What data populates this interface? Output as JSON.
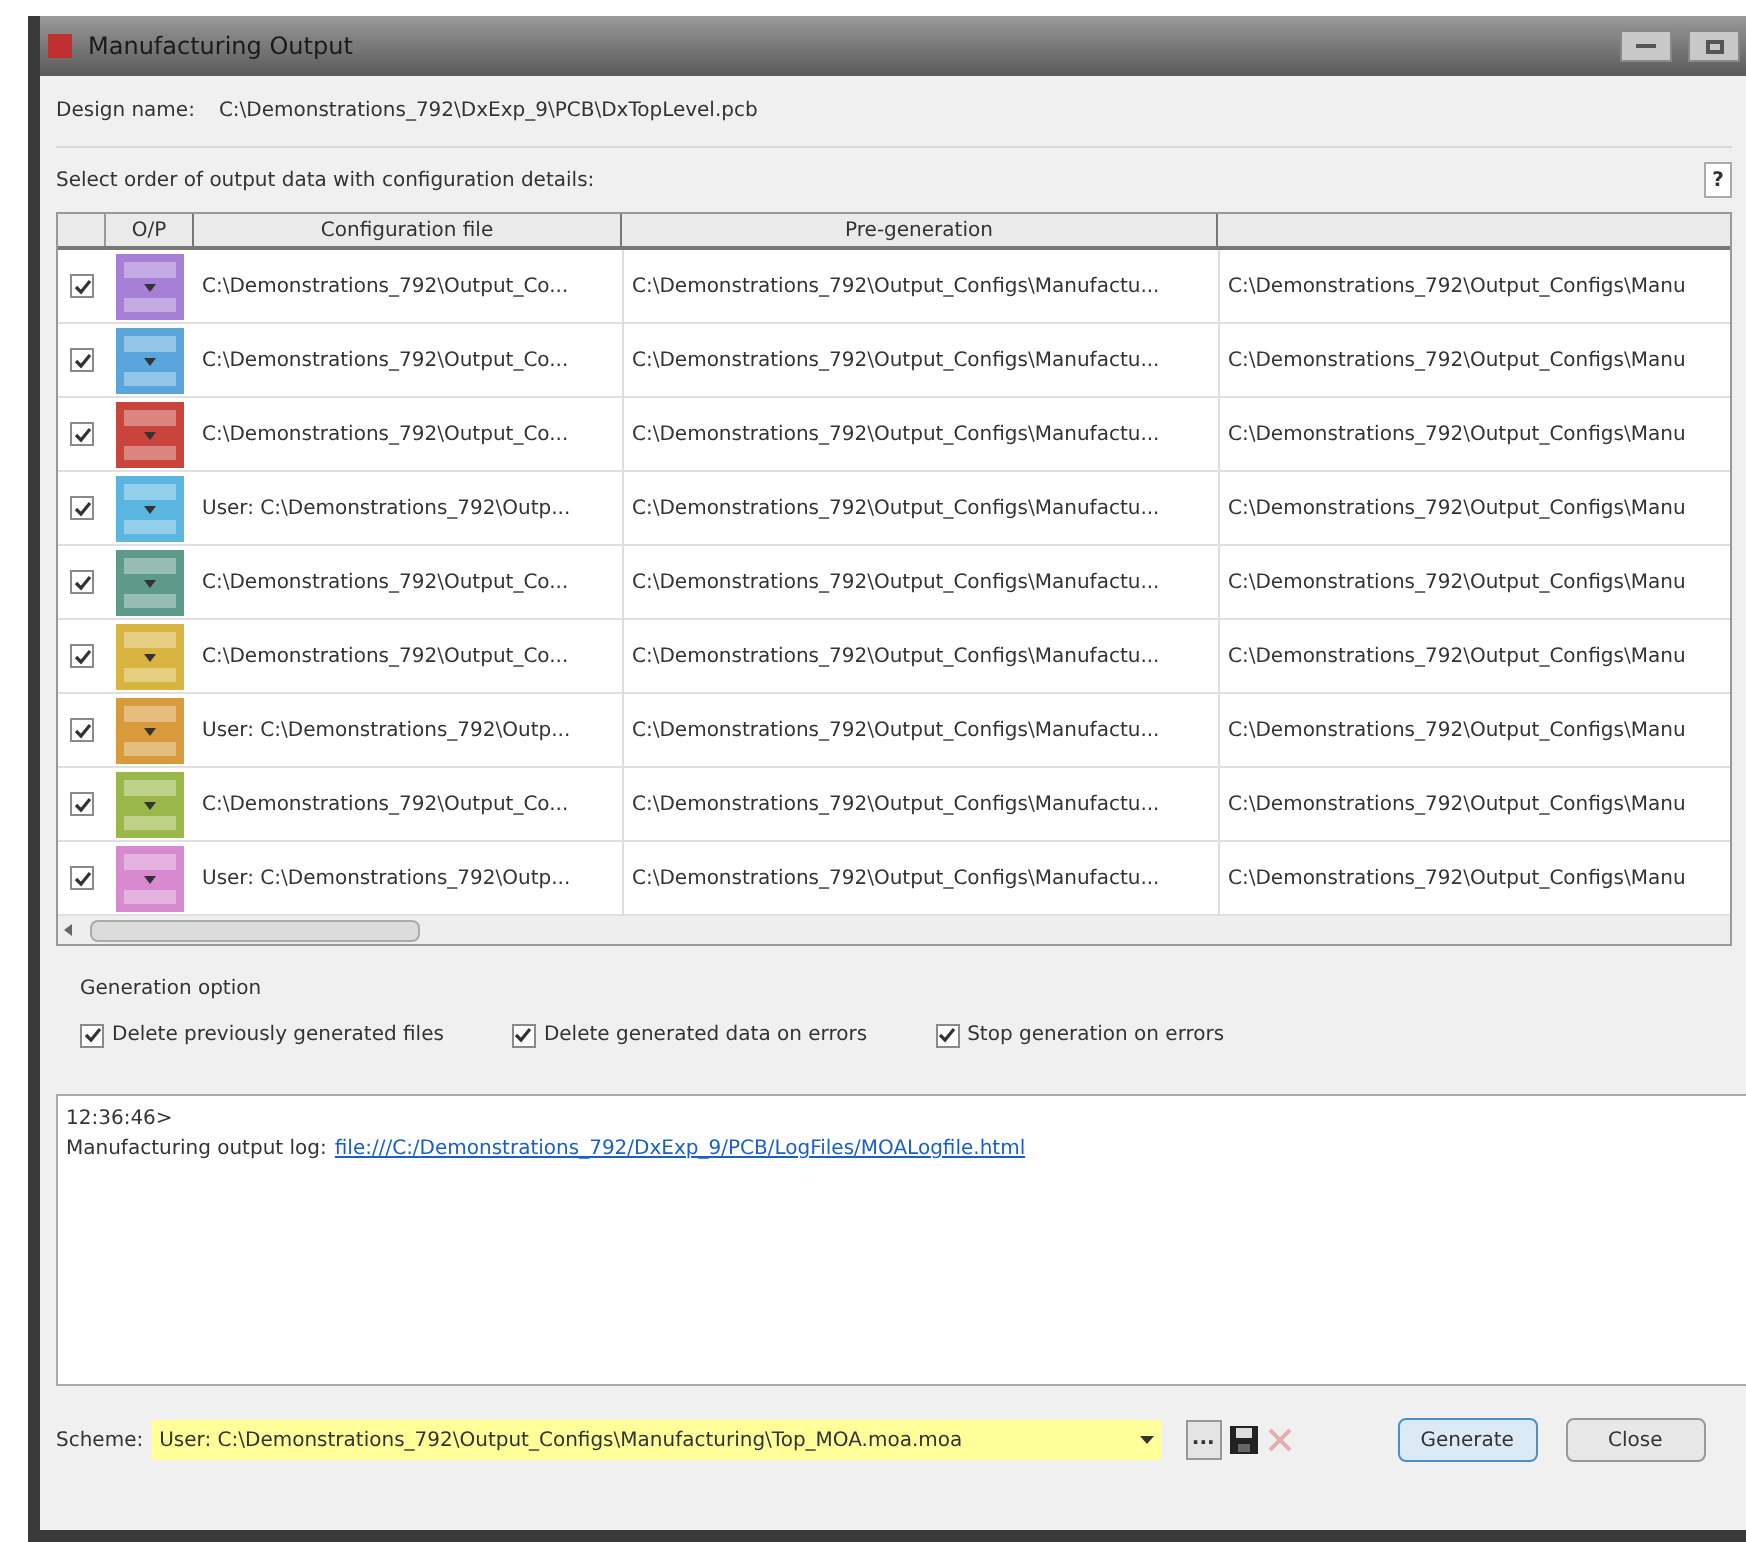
{
  "window": {
    "title": "Manufacturing Output"
  },
  "design_name": {
    "label": "Design name:",
    "value": "C:\\Demonstrations_792\\DxExp_9\\PCB\\DxTopLevel.pcb"
  },
  "order_label": "Select order of output data with configuration details:",
  "help_button": "?",
  "table": {
    "columns": [
      "O/P",
      "Configuration file",
      "Pre-generation"
    ],
    "rows": [
      {
        "checked": true,
        "color": "#a77fd6",
        "config": "C:\\Demonstrations_792\\Output_Co...",
        "pre": "C:\\Demonstrations_792\\Output_Configs\\Manufactu...",
        "column_4": "C:\\Demonstrations_792\\Output_Configs\\Manu"
      },
      {
        "checked": true,
        "color": "#5aa6dc",
        "config": "C:\\Demonstrations_792\\Output_Co...",
        "pre": "C:\\Demonstrations_792\\Output_Configs\\Manufactu...",
        "column_4": "C:\\Demonstrations_792\\Output_Configs\\Manu"
      },
      {
        "checked": true,
        "color": "#c8443c",
        "config": "C:\\Demonstrations_792\\Output_Co...",
        "pre": "C:\\Demonstrations_792\\Output_Configs\\Manufactu...",
        "column_4": "C:\\Demonstrations_792\\Output_Configs\\Manu"
      },
      {
        "checked": true,
        "color": "#5ab6e0",
        "config": "User: C:\\Demonstrations_792\\Outp...",
        "pre": "C:\\Demonstrations_792\\Output_Configs\\Manufactu...",
        "column_4": "C:\\Demonstrations_792\\Output_Configs\\Manu"
      },
      {
        "checked": true,
        "color": "#5e9a8a",
        "config": "C:\\Demonstrations_792\\Output_Co...",
        "pre": "C:\\Demonstrations_792\\Output_Configs\\Manufactu...",
        "column_4": "C:\\Demonstrations_792\\Output_Configs\\Manu"
      },
      {
        "checked": true,
        "color": "#d8b440",
        "config": "C:\\Demonstrations_792\\Output_Co...",
        "pre": "C:\\Demonstrations_792\\Output_Configs\\Manufactu...",
        "column_4": "C:\\Demonstrations_792\\Output_Configs\\Manu"
      },
      {
        "checked": true,
        "color": "#d89a3a",
        "config": "User: C:\\Demonstrations_792\\Outp...",
        "pre": "C:\\Demonstrations_792\\Output_Configs\\Manufactu...",
        "column_4": "C:\\Demonstrations_792\\Output_Configs\\Manu"
      },
      {
        "checked": true,
        "color": "#9ab84a",
        "config": "C:\\Demonstrations_792\\Output_Co...",
        "pre": "C:\\Demonstrations_792\\Output_Configs\\Manufactu...",
        "column_4": "C:\\Demonstrations_792\\Output_Configs\\Manu"
      },
      {
        "checked": true,
        "color": "#d88ad0",
        "config": "User: C:\\Demonstrations_792\\Outp...",
        "pre": "C:\\Demonstrations_792\\Output_Configs\\Manufactu...",
        "column_4": "C:\\Demonstrations_792\\Output_Configs\\Manu"
      }
    ]
  },
  "generation_option": {
    "title": "Generation option",
    "options": [
      {
        "label": "Delete previously generated files",
        "checked": true
      },
      {
        "label": "Delete generated data on errors",
        "checked": true
      },
      {
        "label": "Stop generation on errors",
        "checked": true
      }
    ]
  },
  "log": {
    "time": "12:36:46>",
    "label": "Manufacturing output log:",
    "link": "file:///C:/Demonstrations_792/DxExp_9/PCB/LogFiles/MOALogfile.html"
  },
  "scheme": {
    "label": "Scheme:",
    "value": "User: C:\\Demonstrations_792\\Output_Configs\\Manufacturing\\Top_MOA.moa.moa",
    "browse": "...",
    "delete_disabled": true
  },
  "buttons": [
    "Generate",
    "Close"
  ]
}
